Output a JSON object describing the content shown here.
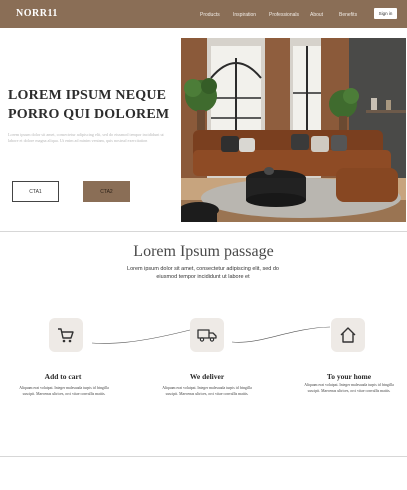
{
  "nav": {
    "brand": "NORR11",
    "items": [
      "Products",
      "Inspiration",
      "Professionals",
      "About",
      "Benefits"
    ],
    "signin": "Sign in",
    "background": "#8a6e56"
  },
  "hero": {
    "title": "LOREM IPSUM NEQUE PORRO QUI DOLOREM",
    "description": "Lorem ipsum dolor sit amet, consectetur adipiscing elit, sed do eiusmod tempor incididunt ut labore et dolore magna aliqua. Ut enim ad minim veniam, quis nostrud exercitation",
    "cta1": "CTA1",
    "cta2": "CTA2",
    "image": "living-room-photo"
  },
  "section": {
    "title": "Lorem Ipsum passage",
    "subtitle": "Lorem ipsum dolor sit amet, consectetur adipiscing elit, sed do eiusmod tempor incididunt ut labore et"
  },
  "steps": [
    {
      "icon": "cart-icon",
      "title": "Add to cart",
      "desc": "Aliquam erat volutpat. Integer malesuada turpis id fringilla suscipit. Maecenas ultrices, orci vitae convallis mattis."
    },
    {
      "icon": "truck-icon",
      "title": "We deliver",
      "desc": "Aliquam erat volutpat. Integer malesuada turpis id fringilla suscipit. Maecenas ultrices, orci vitae convallis mattis."
    },
    {
      "icon": "home-icon",
      "title": "To your home",
      "desc": "Aliquam erat volutpat. Integer malesuada turpis id fringilla suscipit. Maecenas ultrices, orci vitae convallis mattis."
    }
  ]
}
